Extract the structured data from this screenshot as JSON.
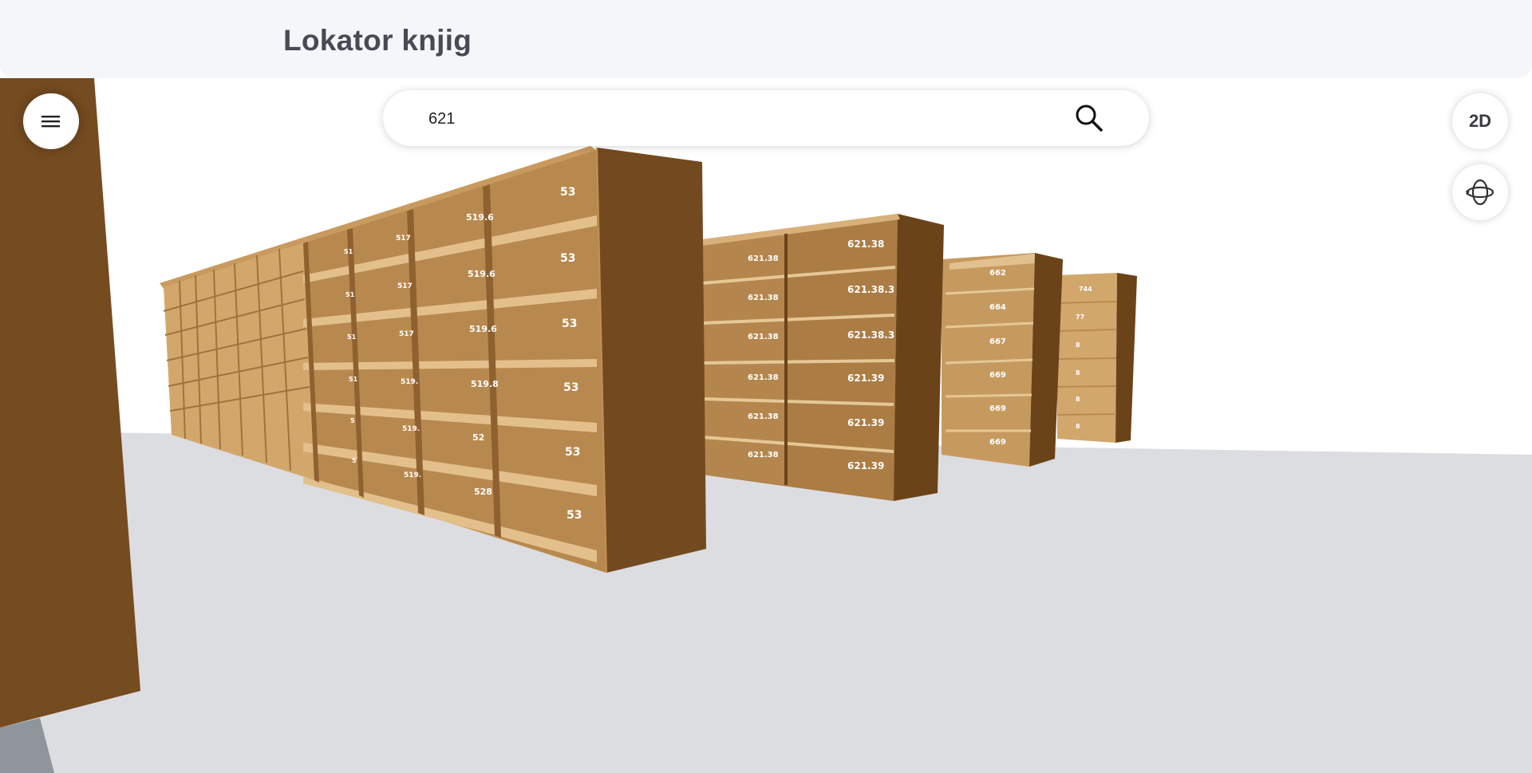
{
  "app": {
    "title": "Lokator knjig"
  },
  "search": {
    "value": "621",
    "placeholder": ""
  },
  "controls": {
    "menu_icon": "hamburger-menu-icon",
    "view_mode_label": "2D",
    "orbit_icon": "orbit-rotate-icon",
    "search_icon": "search-icon"
  },
  "shelves": {
    "bookcase_1": {
      "front_column": [
        "53",
        "53",
        "53",
        "53",
        "53",
        "53"
      ],
      "second_column": [
        "519.6",
        "519.6",
        "519.6",
        "519.8",
        "52",
        "528"
      ],
      "third_column": [
        "517",
        "517",
        "517",
        "519.",
        "519.",
        "519."
      ],
      "fourth_column": [
        "51",
        "51",
        "51",
        "51",
        "5",
        "5"
      ]
    },
    "bookcase_2": {
      "front_column": [
        "621.38",
        "621.38.3",
        "621.38.3",
        "621.39",
        "621.39",
        "621.39"
      ],
      "back_column": [
        "621.38",
        "621.38",
        "621.38",
        "621.38",
        "621.38",
        "621.38"
      ]
    },
    "bookcase_3": {
      "column": [
        "662",
        "664",
        "667",
        "669",
        "669",
        "669"
      ]
    },
    "bookcase_4": {
      "column": [
        "744",
        "77",
        "8",
        "8",
        "8",
        "8"
      ]
    }
  },
  "colors": {
    "topbar_bg": "#f5f6f9",
    "wood_dark": "#734a1f",
    "wood_mid": "#a87a43",
    "wood_light": "#d9b07a",
    "floor": "#dcdde0",
    "wall": "#ffffff"
  }
}
